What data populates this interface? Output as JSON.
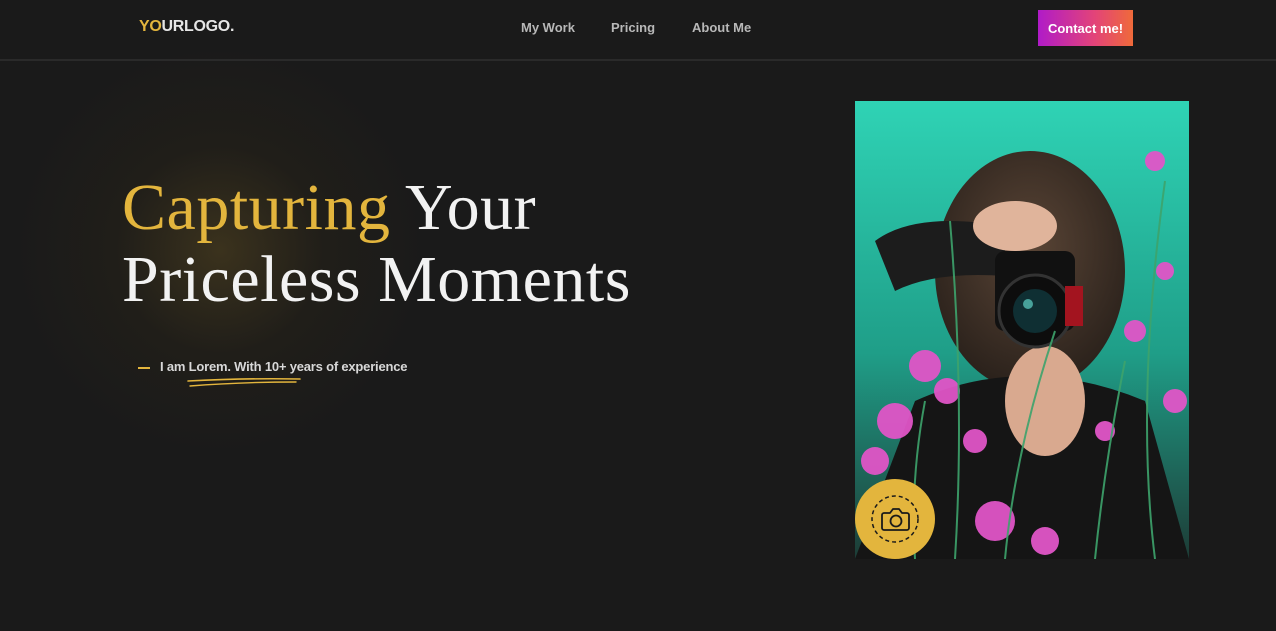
{
  "logo": {
    "accent": "YO",
    "rest": "URLOGO."
  },
  "nav": {
    "items": [
      {
        "label": "My Work"
      },
      {
        "label": "Pricing"
      },
      {
        "label": "About Me"
      }
    ],
    "cta": "Contact me!"
  },
  "hero": {
    "headline_accent": "Capturing",
    "headline_rest_line1": " Your",
    "headline_line2": "Priceless Moments",
    "tagline": "I am Lorem. With 10+ years of experience"
  },
  "icons": {
    "badge": "camera-icon"
  },
  "colors": {
    "background": "#1a1a1a",
    "accent": "#e3b53d",
    "cta_gradient_start": "#b01bc8",
    "cta_gradient_end": "#ef6a3a",
    "photo_sky": "#2fd3b5",
    "flowers": "#e055c7"
  }
}
